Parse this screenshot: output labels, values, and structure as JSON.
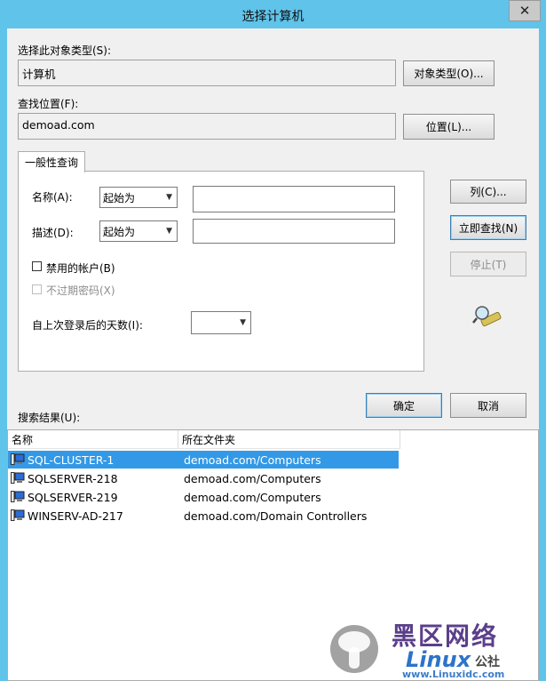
{
  "window": {
    "title": "选择计算机",
    "close_icon": "✕"
  },
  "object_type": {
    "label": "选择此对象类型(S):",
    "value": "计算机",
    "button": "对象类型(O)..."
  },
  "location": {
    "label": "查找位置(F):",
    "value": "demoad.com",
    "button": "位置(L)..."
  },
  "query": {
    "tab": "一般性查询",
    "name_label": "名称(A):",
    "name_mode": "起始为",
    "name_value": "",
    "desc_label": "描述(D):",
    "desc_mode": "起始为",
    "desc_value": "",
    "disabled_accounts": {
      "label": "禁用的帐户(B)",
      "checked": false
    },
    "non_expiring": {
      "label": "不过期密码(X)",
      "checked": false,
      "enabled": false
    },
    "days_label": "自上次登录后的天数(I):",
    "days_value": ""
  },
  "side_buttons": {
    "columns": "列(C)...",
    "find_now": "立即查找(N)",
    "stop": "停止(T)"
  },
  "ok": "确定",
  "cancel": "取消",
  "results": {
    "label": "搜索结果(U):",
    "columns": [
      "名称",
      "所在文件夹"
    ],
    "rows": [
      {
        "name": "SQL-CLUSTER-1",
        "folder": "demoad.com/Computers",
        "selected": true
      },
      {
        "name": "SQLSERVER-218",
        "folder": "demoad.com/Computers",
        "selected": false
      },
      {
        "name": "SQLSERVER-219",
        "folder": "demoad.com/Computers",
        "selected": false
      },
      {
        "name": "WINSERV-AD-217",
        "folder": "demoad.com/Domain Controllers",
        "selected": false
      }
    ]
  },
  "watermark": {
    "text_cn": "黑区网络",
    "text_brand": "Linux",
    "text_site": "www.Linuxidc.com",
    "text_corner": "公社"
  },
  "colors": {
    "titlebar": "#5fc3ea",
    "selection": "#3399e6",
    "client": "#f0f0f0"
  }
}
